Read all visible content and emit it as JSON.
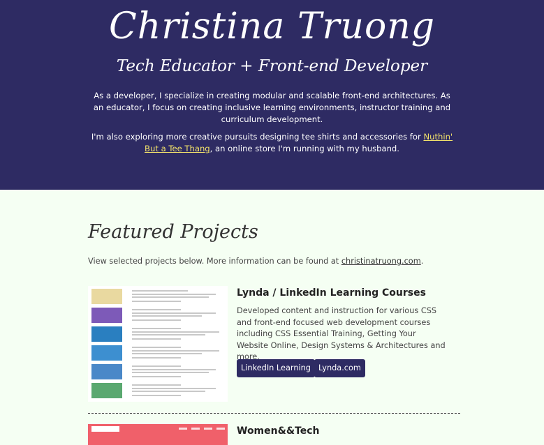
{
  "hero": {
    "name": "Christina Truong",
    "tagline": "Tech Educator + Front-end Developer",
    "para1": "As a developer, I specialize in creating modular and scalable front-end architectures. As an educator, I focus on creating inclusive learning environments, instructor training and curriculum development.",
    "para2_before": "I'm also exploring more creative pursuits designing tee shirts and accessories for ",
    "para2_link": "Nuthin' But a Tee Thang",
    "para2_after": ", an online store I'm running with my husband."
  },
  "featured": {
    "title": "Featured Projects",
    "intro_before": "View selected projects below. More information can be found at ",
    "intro_link": "christinatruong.com",
    "intro_after": "."
  },
  "projects": [
    {
      "title": "Lynda / LinkedIn Learning Courses",
      "description": "Developed content and instruction for various CSS and front-end focused web development courses including CSS Essential Training, Getting Your Website Online, Design Systems & Architectures and more.",
      "buttons": [
        "LinkedIn Learning",
        "Lynda.com"
      ]
    },
    {
      "title": "Women&&Tech"
    }
  ],
  "colors": {
    "hero_bg": "#2e2b63",
    "page_bg": "#f5fff3",
    "link_accent": "#f3e36b",
    "button_bg": "#2e2b63",
    "thumb2_bg": "#f0606a"
  }
}
